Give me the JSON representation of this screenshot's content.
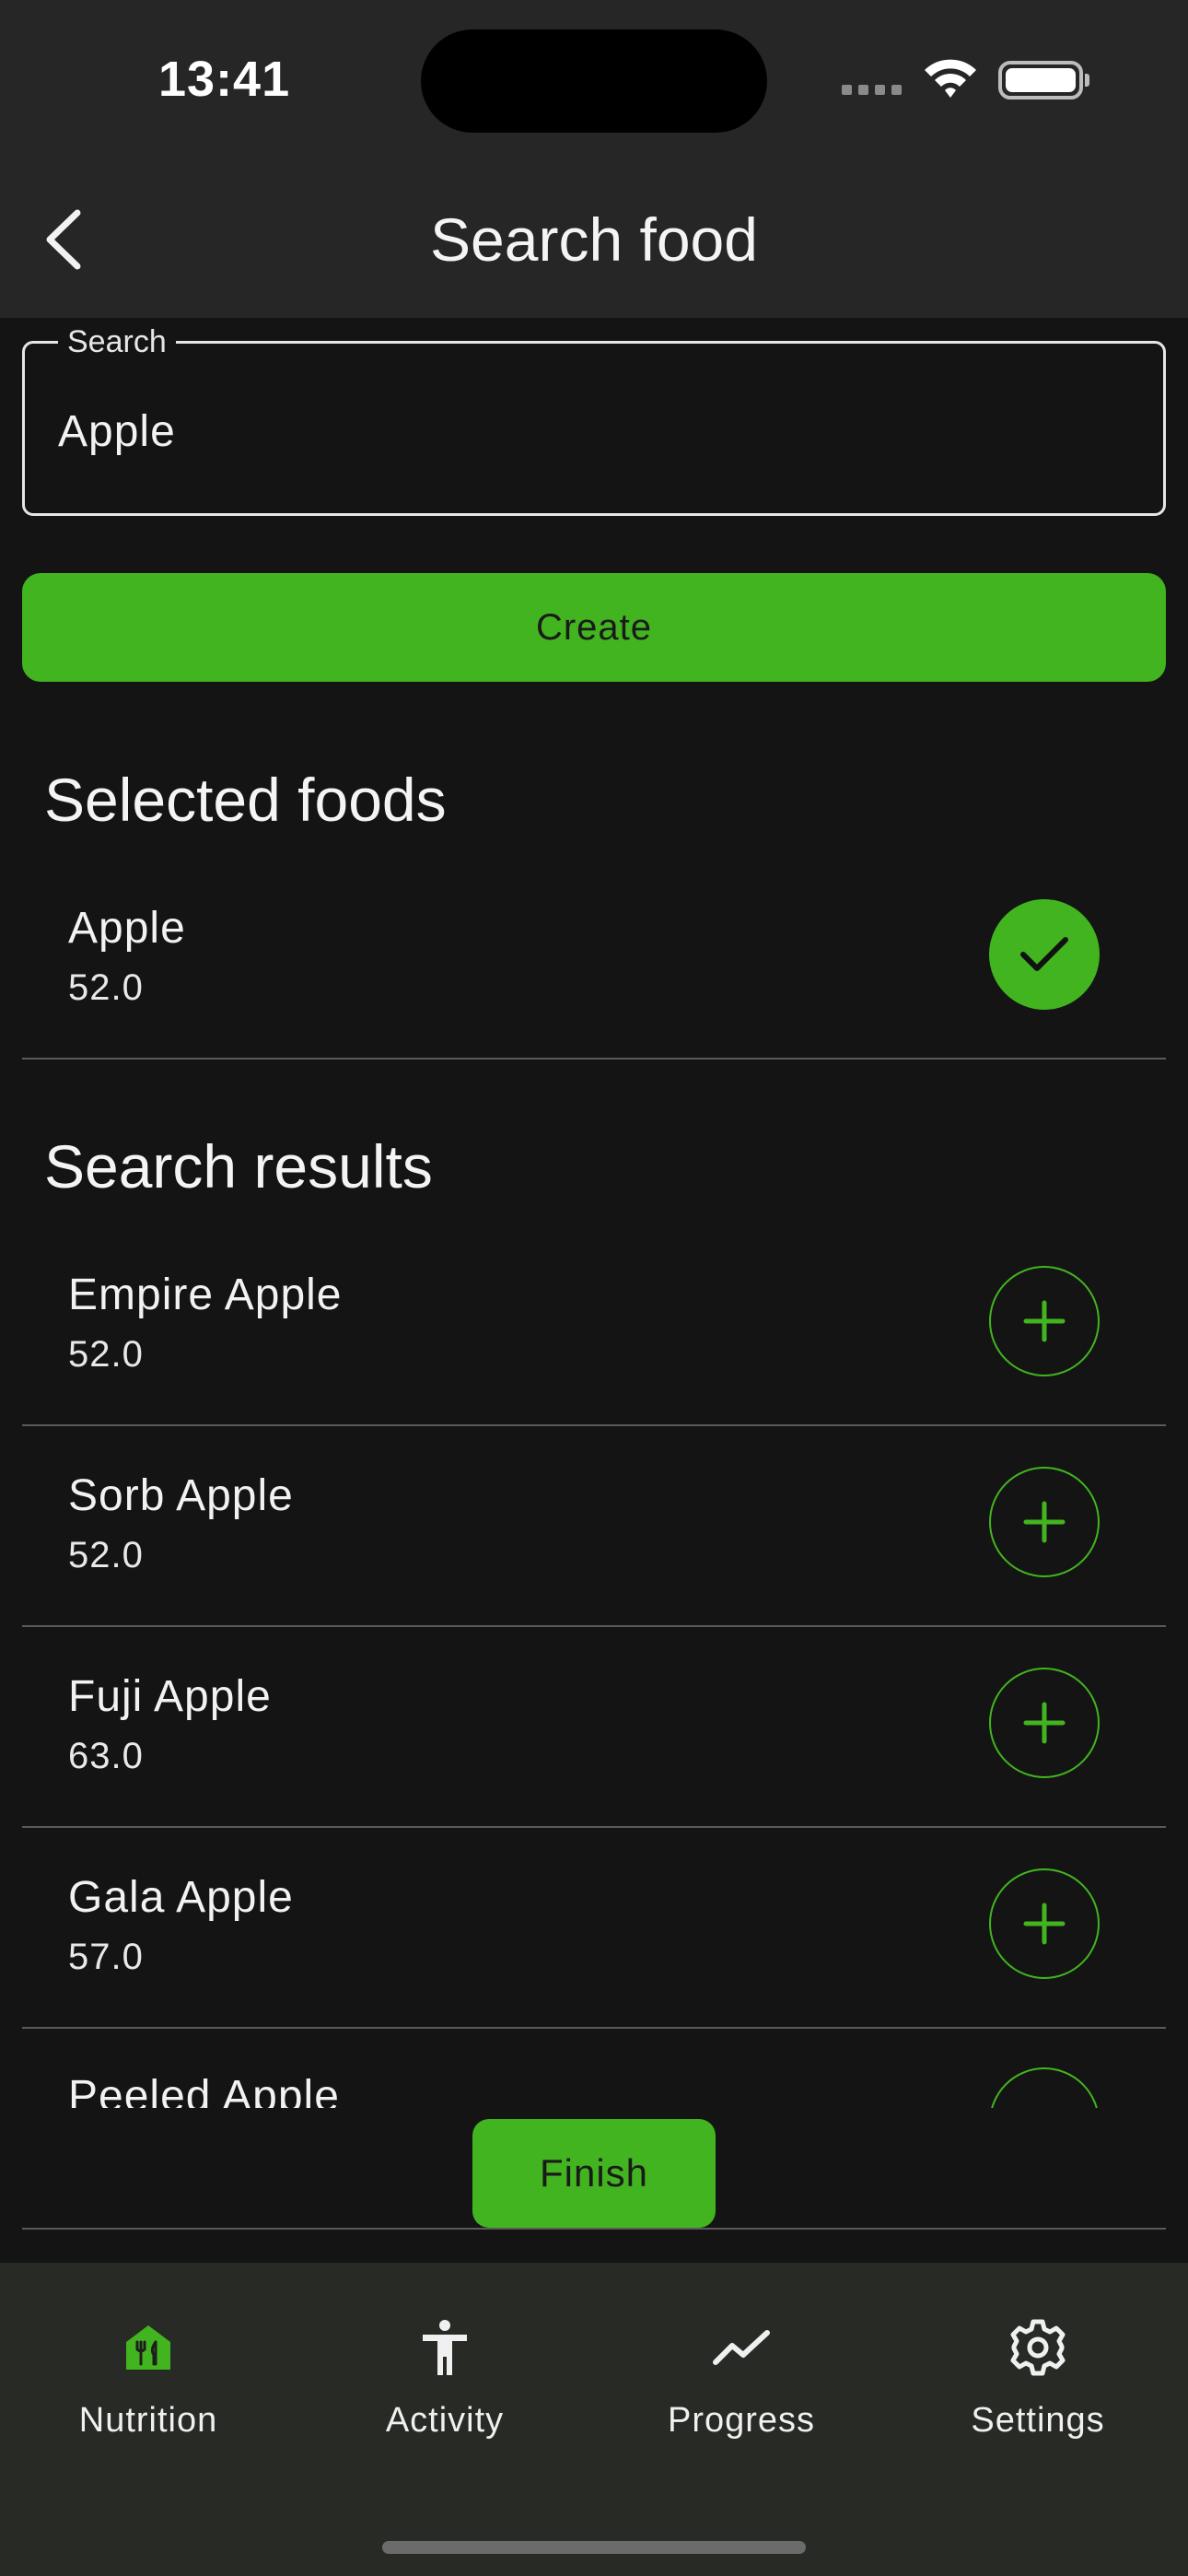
{
  "status_bar": {
    "time": "13:41"
  },
  "header": {
    "title": "Search food"
  },
  "search": {
    "label": "Search",
    "value": "Apple"
  },
  "create_button": {
    "label": "Create"
  },
  "selected_section": {
    "title": "Selected foods",
    "items": [
      {
        "name": "Apple",
        "value": "52.0"
      }
    ]
  },
  "results_section": {
    "title": "Search results",
    "items": [
      {
        "name": "Empire Apple",
        "value": "52.0"
      },
      {
        "name": "Sorb Apple",
        "value": "52.0"
      },
      {
        "name": "Fuji Apple",
        "value": "63.0"
      },
      {
        "name": "Gala Apple",
        "value": "57.0"
      },
      {
        "name": "Peeled Apple",
        "value": ""
      }
    ]
  },
  "finish_button": {
    "label": "Finish"
  },
  "bottom_nav": {
    "items": [
      {
        "label": "Nutrition",
        "icon": "nutrition-icon",
        "active": true
      },
      {
        "label": "Activity",
        "icon": "activity-icon",
        "active": false
      },
      {
        "label": "Progress",
        "icon": "progress-icon",
        "active": false
      },
      {
        "label": "Settings",
        "icon": "settings-icon",
        "active": false
      }
    ]
  },
  "colors": {
    "accent": "#42b41f",
    "background": "#141414",
    "header": "#262626",
    "nav_background": "#272a25"
  }
}
